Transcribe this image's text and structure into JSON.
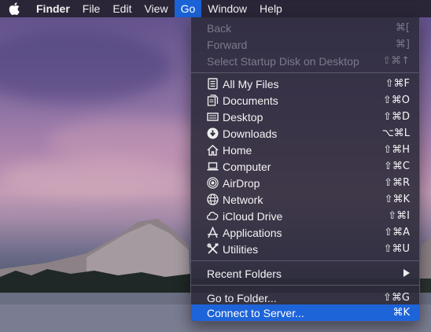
{
  "menubar": {
    "apple_icon": "apple-icon",
    "app_name": "Finder",
    "items": [
      "File",
      "Edit",
      "View",
      "Go",
      "Window",
      "Help"
    ],
    "active_menu": "Go"
  },
  "go_menu": {
    "history": [
      {
        "label": "Back",
        "shortcut": "⌘[",
        "enabled": false
      },
      {
        "label": "Forward",
        "shortcut": "⌘]",
        "enabled": false
      },
      {
        "label": "Select Startup Disk on Desktop",
        "shortcut": "⇧⌘↑",
        "enabled": false
      }
    ],
    "places": [
      {
        "label": "All My Files",
        "shortcut": "⇧⌘F",
        "icon": "all-files-icon"
      },
      {
        "label": "Documents",
        "shortcut": "⇧⌘O",
        "icon": "documents-icon"
      },
      {
        "label": "Desktop",
        "shortcut": "⇧⌘D",
        "icon": "desktop-icon"
      },
      {
        "label": "Downloads",
        "shortcut": "⌥⌘L",
        "icon": "downloads-icon"
      },
      {
        "label": "Home",
        "shortcut": "⇧⌘H",
        "icon": "home-icon"
      },
      {
        "label": "Computer",
        "shortcut": "⇧⌘C",
        "icon": "computer-icon"
      },
      {
        "label": "AirDrop",
        "shortcut": "⇧⌘R",
        "icon": "airdrop-icon"
      },
      {
        "label": "Network",
        "shortcut": "⇧⌘K",
        "icon": "network-icon"
      },
      {
        "label": "iCloud Drive",
        "shortcut": "⇧⌘I",
        "icon": "icloud-icon"
      },
      {
        "label": "Applications",
        "shortcut": "⇧⌘A",
        "icon": "applications-icon"
      },
      {
        "label": "Utilities",
        "shortcut": "⇧⌘U",
        "icon": "utilities-icon"
      }
    ],
    "recent_folders": {
      "label": "Recent Folders",
      "icon": "submenu-arrow-icon"
    },
    "go_to_folder": {
      "label": "Go to Folder...",
      "shortcut": "⇧⌘G"
    },
    "connect_to_server": {
      "label": "Connect to Server...",
      "shortcut": "⌘K",
      "selected": true
    }
  },
  "colors": {
    "menubar_bg": "#262230",
    "active_highlight": "#1a62d6",
    "menu_bg": "#2c2a3a",
    "disabled_text": "#7d7a8c"
  }
}
